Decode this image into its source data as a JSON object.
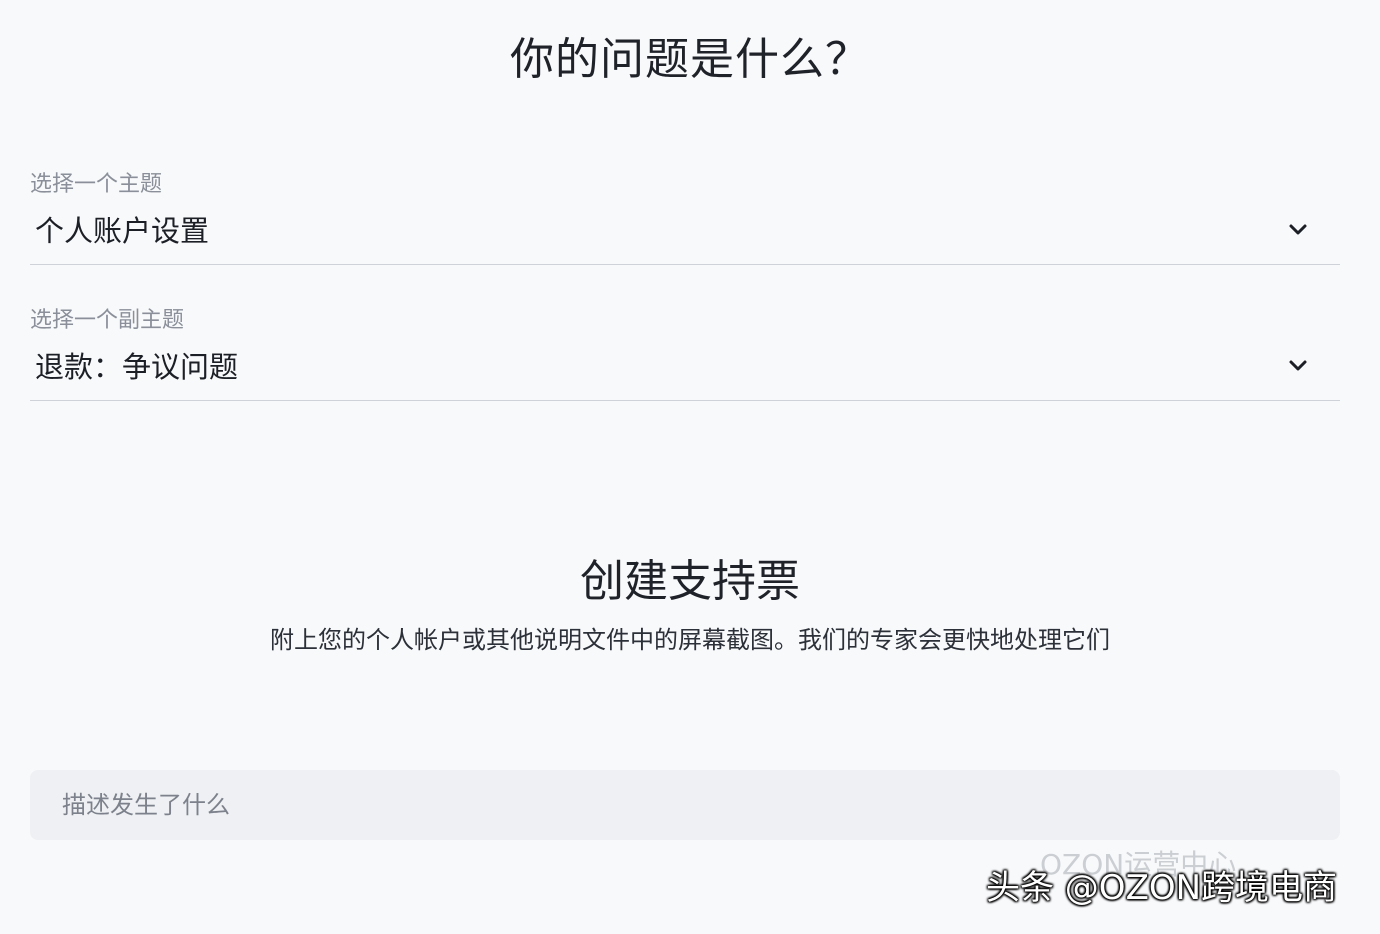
{
  "page": {
    "title": "你的问题是什么？"
  },
  "topic_select": {
    "label": "选择一个主题",
    "value": "个人账户设置",
    "icon": "chevron-down-icon"
  },
  "subtopic_select": {
    "label": "选择一个副主题",
    "value": "退款：争议问题",
    "icon": "chevron-down-icon"
  },
  "ticket": {
    "title": "创建支持票",
    "description": "附上您的个人帐户或其他说明文件中的屏幕截图。我们的专家会更快地处理它们",
    "textarea_placeholder": "描述发生了什么"
  },
  "watermark": {
    "faint": "OZON运营中心",
    "main": "头条 @OZON跨境电商"
  },
  "colors": {
    "background": "#f8f9fb",
    "text": "#1c1f26",
    "muted": "#8a8f99",
    "divider": "#cfd2d8",
    "input_bg": "#eef0f3"
  }
}
